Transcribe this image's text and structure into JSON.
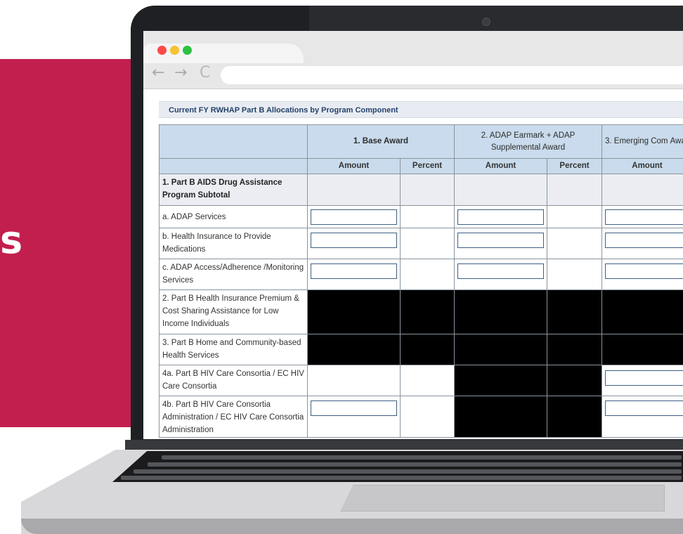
{
  "marketing": {
    "partial_heading": "s"
  },
  "browser": {
    "back_icon": "←",
    "forward_icon": "→",
    "reload_icon": "C",
    "address": ""
  },
  "page": {
    "title": "Current FY RWHAP Part B Allocations by Program Component",
    "columns": {
      "base_award": "1. Base Award",
      "adap_earmark": "2. ADAP Earmark + ADAP Supplemental Award",
      "emerging": "3. Emerging Com Awar"
    },
    "subheaders": {
      "amount": "Amount",
      "percent": "Percent"
    },
    "rows": [
      {
        "label": "1. Part B AIDS Drug Assistance Program Subtotal"
      },
      {
        "label": "a. ADAP Services"
      },
      {
        "label": "b. Health Insurance to Provide Medications"
      },
      {
        "label": "c. ADAP Access/Adherence /Monitoring Services"
      },
      {
        "label": "2. Part B Health Insurance Premium & Cost Sharing Assistance for Low Income Individuals"
      },
      {
        "label": "3. Part B Home and Community-based Health Services"
      },
      {
        "label": "4a. Part B HIV Care Consortia / EC HIV Care Consortia"
      },
      {
        "label": "4b. Part B HIV Care Consortia Administration / EC HIV Care Consortia Administration"
      }
    ]
  },
  "colors": {
    "accent_crimson": "#c21f4e",
    "header_blue": "#c9dbec",
    "title_navy": "#24426a"
  }
}
